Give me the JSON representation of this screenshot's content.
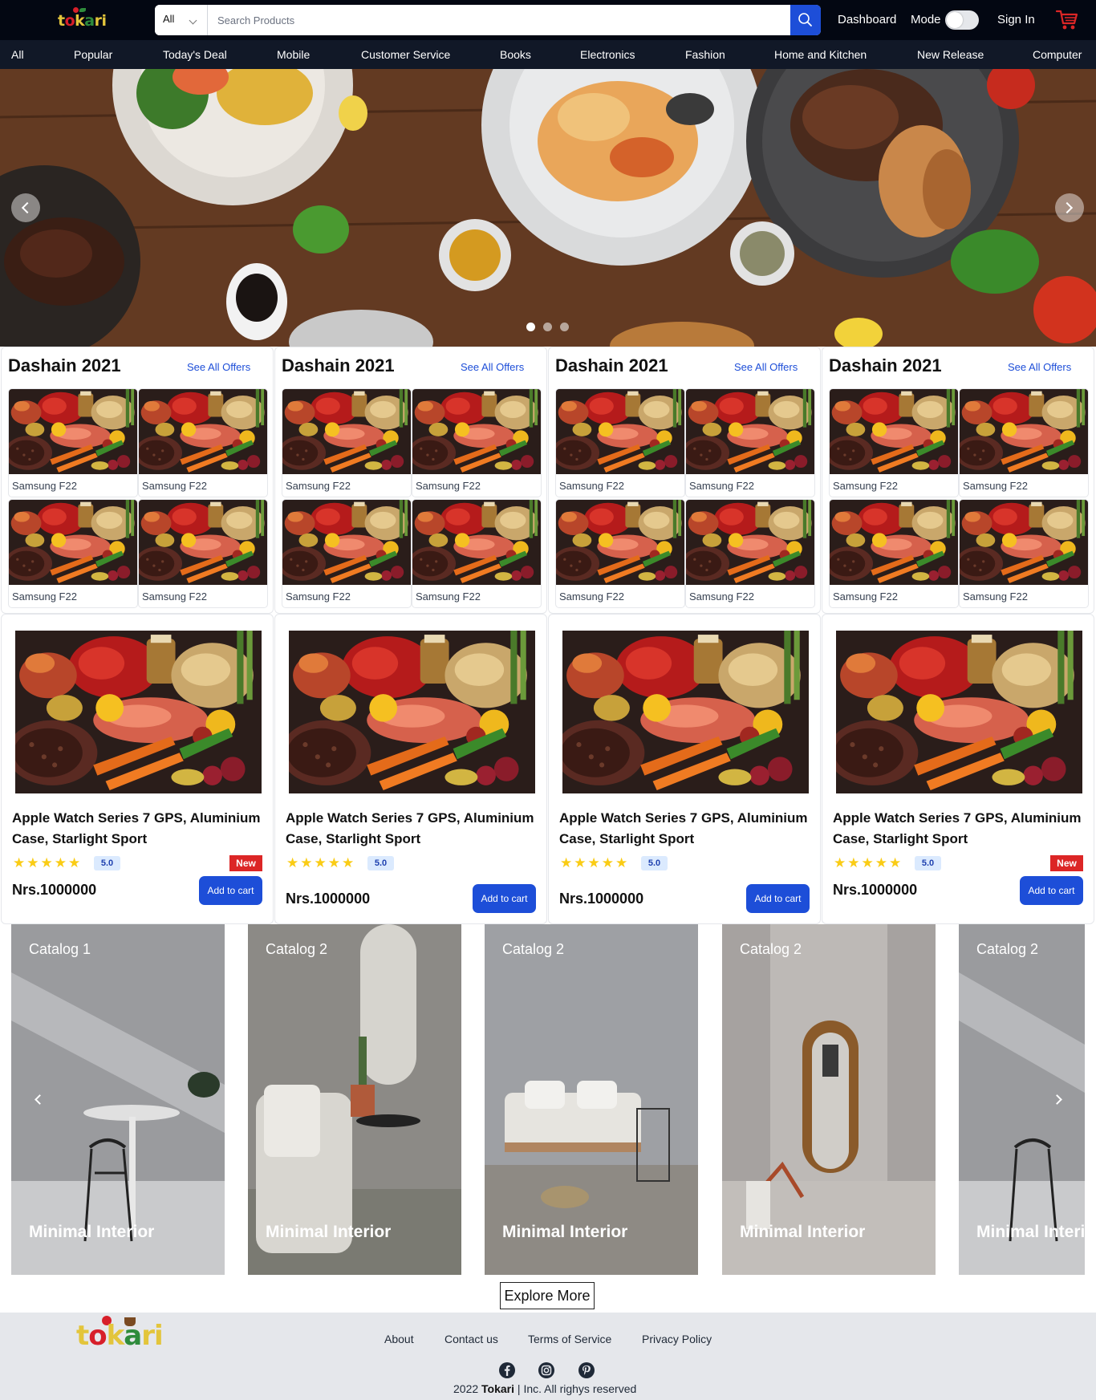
{
  "header": {
    "logo_text": "tokari",
    "search": {
      "category": "All",
      "placeholder": "Search Products"
    },
    "dashboard_label": "Dashboard",
    "mode_label": "Mode",
    "signin_label": "Sign In"
  },
  "nav": {
    "items": [
      "All",
      "Popular",
      "Today's Deal",
      "Mobile",
      "Customer Service",
      "Books",
      "Electronics",
      "Fashion",
      "Home and Kitchen",
      "New Release",
      "Computer"
    ]
  },
  "hero": {
    "slides": 3,
    "active_slide": 1
  },
  "offers": [
    {
      "title": "Dashain 2021",
      "link": "See All Offers",
      "tiles": [
        "Samsung F22",
        "Samsung F22",
        "Samsung F22",
        "Samsung F22"
      ]
    },
    {
      "title": "Dashain 2021",
      "link": "See All Offers",
      "tiles": [
        "Samsung F22",
        "Samsung F22",
        "Samsung F22",
        "Samsung F22"
      ]
    },
    {
      "title": "Dashain 2021",
      "link": "See All Offers",
      "tiles": [
        "Samsung F22",
        "Samsung F22",
        "Samsung F22",
        "Samsung F22"
      ]
    },
    {
      "title": "Dashain 2021",
      "link": "See All Offers",
      "tiles": [
        "Samsung F22",
        "Samsung F22",
        "Samsung F22",
        "Samsung F22"
      ]
    }
  ],
  "products": [
    {
      "name": "Apple Watch Series 7 GPS, Aluminium Case, Starlight Sport",
      "stars": "★★★★★",
      "rating": "5.0",
      "badge": "New",
      "price": "Nrs.1000000",
      "cart_label": "Add to cart"
    },
    {
      "name": "Apple Watch Series 7 GPS, Aluminium Case, Starlight Sport",
      "stars": "★★★★★",
      "rating": "5.0",
      "badge": "",
      "price": "Nrs.1000000",
      "cart_label": "Add to cart"
    },
    {
      "name": "Apple Watch Series 7 GPS, Aluminium Case, Starlight Sport",
      "stars": "★★★★★",
      "rating": "5.0",
      "badge": "",
      "price": "Nrs.1000000",
      "cart_label": "Add to cart"
    },
    {
      "name": "Apple Watch Series 7 GPS, Aluminium Case, Starlight Sport",
      "stars": "★★★★★",
      "rating": "5.0",
      "badge": "New",
      "price": "Nrs.1000000",
      "cart_label": "Add to cart"
    }
  ],
  "catalogs": [
    {
      "label": "Catalog 1",
      "caption": "Minimal Interior"
    },
    {
      "label": "Catalog 2",
      "caption": "Minimal Interior"
    },
    {
      "label": "Catalog 2",
      "caption": "Minimal Interior"
    },
    {
      "label": "Catalog 2",
      "caption": "Minimal Interior"
    },
    {
      "label": "Catalog 2",
      "caption": "Minimal Interior"
    }
  ],
  "explore_label": "Explore More",
  "footer": {
    "links": [
      "About",
      "Contact us",
      "Terms of Service",
      "Privacy Policy"
    ],
    "social_icons": [
      "facebook-icon",
      "instagram-icon",
      "pinterest-icon"
    ],
    "copyright_year": "2022",
    "brand": "Tokari",
    "copyright_rest": "|  Inc. All righys reserved"
  },
  "colors": {
    "header_bg": "#030712",
    "nav_bg": "#111827",
    "accent_blue": "#1d4ed8",
    "badge_red": "#dc2626",
    "star_yellow": "#facc15",
    "footer_bg": "#e5e7eb"
  }
}
